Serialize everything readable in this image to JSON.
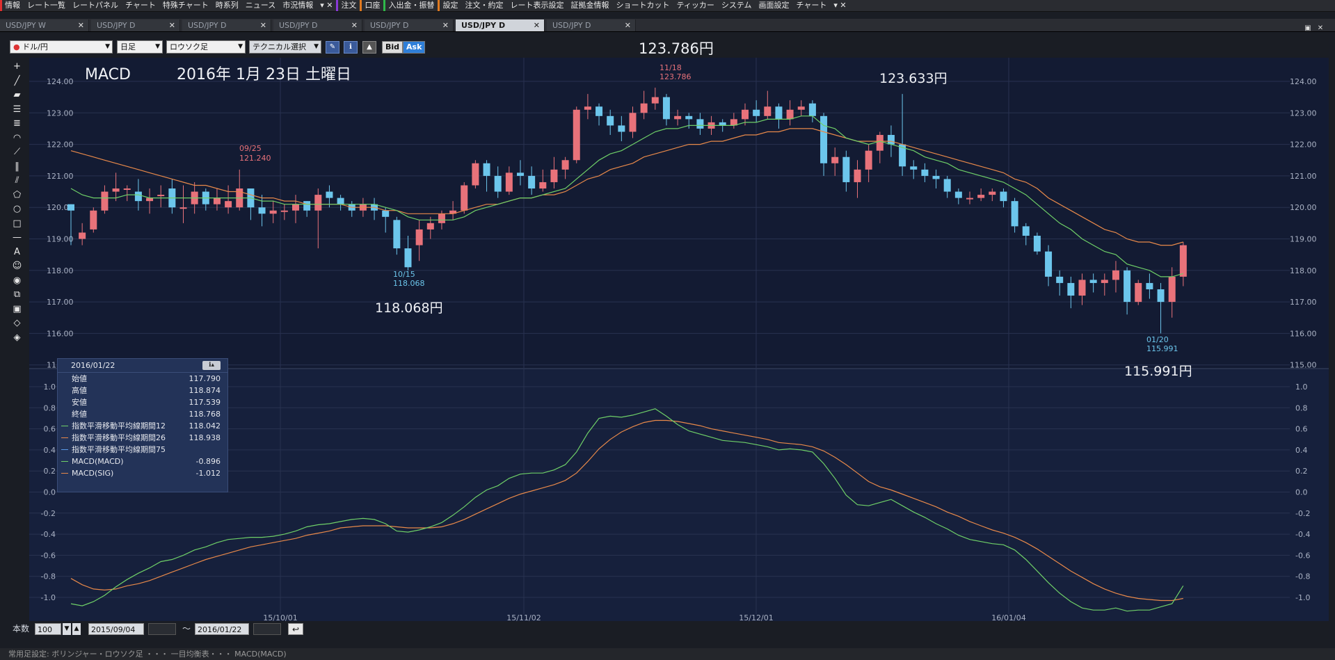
{
  "menubar": {
    "items": [
      {
        "label": "情報",
        "accent": "#e03030"
      },
      {
        "label": "レート一覧",
        "accent": ""
      },
      {
        "label": "レートパネル",
        "accent": ""
      },
      {
        "label": "チャート",
        "accent": ""
      },
      {
        "label": "特殊チャート",
        "accent": ""
      },
      {
        "label": "時系列",
        "accent": ""
      },
      {
        "label": "ニュース",
        "accent": ""
      },
      {
        "label": "市況情報",
        "accent": ""
      },
      {
        "label": "▾ ✕",
        "accent": ""
      },
      {
        "label": "注文",
        "accent": "#8a3ad8"
      },
      {
        "label": "口座",
        "accent": "#e07a20"
      },
      {
        "label": "入出金・振替",
        "accent": "#2fb84a"
      },
      {
        "label": "設定",
        "accent": "#e07a20"
      },
      {
        "label": "注文・約定",
        "accent": ""
      },
      {
        "label": "レート表示設定",
        "accent": ""
      },
      {
        "label": "証拠金情報",
        "accent": ""
      },
      {
        "label": "ショートカット",
        "accent": ""
      },
      {
        "label": "ティッカー",
        "accent": ""
      },
      {
        "label": "システム",
        "accent": ""
      },
      {
        "label": "画面設定",
        "accent": ""
      },
      {
        "label": "チャート",
        "accent": ""
      },
      {
        "label": "▾ ✕",
        "accent": ""
      }
    ]
  },
  "tabs": [
    {
      "label": "USD/JPY W",
      "active": false
    },
    {
      "label": "USD/JPY D",
      "active": false
    },
    {
      "label": "USD/JPY D",
      "active": false
    },
    {
      "label": "USD/JPY D",
      "active": false
    },
    {
      "label": "USD/JPY D",
      "active": false
    },
    {
      "label": "USD/JPY D",
      "active": true
    },
    {
      "label": "USD/JPY D",
      "active": false
    }
  ],
  "toolbar": {
    "pair": "ドル/円",
    "period": "日足",
    "chart_type": "ロウソク足",
    "technical": "テクニカル選択",
    "bid": "Bid",
    "ask": "Ask"
  },
  "top_price": "123.786円",
  "chart": {
    "title": "MACD",
    "date": "2016年 1月 23日 土曜日",
    "annotations": {
      "high1_date": "09/25",
      "high1_val": "121.240",
      "low1_date": "10/15",
      "low1_val": "118.068",
      "high2_date": "11/18",
      "high2_val": "123.786",
      "low2_date": "01/20",
      "low2_val": "115.991"
    },
    "big_labels": {
      "low1": "118.068円",
      "high": "123.633円",
      "low2": "115.991円"
    },
    "x_labels": [
      "15/10/01",
      "15/11/02",
      "15/12/01",
      "16/01/04"
    ],
    "price_ticks": [
      "124.00",
      "123.00",
      "122.00",
      "121.00",
      "120.00",
      "119.00",
      "118.00",
      "117.00",
      "116.00",
      "115.00"
    ],
    "macd_ticks": [
      "1.0",
      "0.8",
      "0.6",
      "0.4",
      "0.2",
      "0.0",
      "-0.2",
      "-0.4",
      "-0.6",
      "-0.8",
      "-1.0"
    ]
  },
  "chart_data": {
    "type": "candlestick",
    "price_range": [
      115.0,
      124.3
    ],
    "candles": [
      [
        120.1,
        119.9,
        120.1,
        118.8
      ],
      [
        119.0,
        119.2,
        119.5,
        118.8
      ],
      [
        119.3,
        119.9,
        120.0,
        119.2
      ],
      [
        119.9,
        120.5,
        120.7,
        119.8
      ],
      [
        120.5,
        120.6,
        121.1,
        120.2
      ],
      [
        120.6,
        120.6,
        120.7,
        120.2
      ],
      [
        120.5,
        120.2,
        120.9,
        119.9
      ],
      [
        120.2,
        120.3,
        120.6,
        119.8
      ],
      [
        120.4,
        120.4,
        120.7,
        120.0
      ],
      [
        120.6,
        120.0,
        120.9,
        119.8
      ],
      [
        120.0,
        120.0,
        120.7,
        119.5
      ],
      [
        120.1,
        120.5,
        120.8,
        119.8
      ],
      [
        120.5,
        120.1,
        120.6,
        119.9
      ],
      [
        120.1,
        120.3,
        120.6,
        119.9
      ],
      [
        120.0,
        120.2,
        120.7,
        119.8
      ],
      [
        120.0,
        120.6,
        121.2,
        119.9
      ],
      [
        120.6,
        120.0,
        120.6,
        119.6
      ],
      [
        120.0,
        119.8,
        120.4,
        119.4
      ],
      [
        119.8,
        119.9,
        120.2,
        119.5
      ],
      [
        119.9,
        119.9,
        120.1,
        119.6
      ],
      [
        119.9,
        120.1,
        120.4,
        119.5
      ],
      [
        120.2,
        119.9,
        120.2,
        119.7
      ],
      [
        119.9,
        120.4,
        120.6,
        118.7
      ],
      [
        120.5,
        120.3,
        120.7,
        120.0
      ],
      [
        120.3,
        120.1,
        120.4,
        119.9
      ],
      [
        120.1,
        119.9,
        120.2,
        119.7
      ],
      [
        119.9,
        120.1,
        120.3,
        119.7
      ],
      [
        120.1,
        119.9,
        120.3,
        119.6
      ],
      [
        119.9,
        119.7,
        120.0,
        119.2
      ],
      [
        119.6,
        118.7,
        119.7,
        118.5
      ],
      [
        118.7,
        118.1,
        119.1,
        118.0
      ],
      [
        118.8,
        119.3,
        119.6,
        118.3
      ],
      [
        119.3,
        119.5,
        119.7,
        119.0
      ],
      [
        119.5,
        119.8,
        119.9,
        119.3
      ],
      [
        119.8,
        119.9,
        120.2,
        119.6
      ],
      [
        119.9,
        120.7,
        120.8,
        119.8
      ],
      [
        120.7,
        121.4,
        121.5,
        120.6
      ],
      [
        121.4,
        121.0,
        121.5,
        120.5
      ],
      [
        121.0,
        120.5,
        121.3,
        120.3
      ],
      [
        120.5,
        121.1,
        121.3,
        120.4
      ],
      [
        121.1,
        121.0,
        121.5,
        120.7
      ],
      [
        121.0,
        120.6,
        121.3,
        120.4
      ],
      [
        120.6,
        120.8,
        121.2,
        120.5
      ],
      [
        120.8,
        121.2,
        121.6,
        120.6
      ],
      [
        121.2,
        121.5,
        121.6,
        120.9
      ],
      [
        121.5,
        123.1,
        123.2,
        121.4
      ],
      [
        123.1,
        123.2,
        123.6,
        122.8
      ],
      [
        123.2,
        122.9,
        123.3,
        122.6
      ],
      [
        122.9,
        122.6,
        123.1,
        122.3
      ],
      [
        122.6,
        122.4,
        122.9,
        122.1
      ],
      [
        122.4,
        123.0,
        123.2,
        122.2
      ],
      [
        123.0,
        123.3,
        123.7,
        122.8
      ],
      [
        123.3,
        123.5,
        123.8,
        123.1
      ],
      [
        123.5,
        122.8,
        123.6,
        122.6
      ],
      [
        122.8,
        122.9,
        123.1,
        122.6
      ],
      [
        122.9,
        122.8,
        123.0,
        122.5
      ],
      [
        122.8,
        122.5,
        123.0,
        122.3
      ],
      [
        122.5,
        122.7,
        122.9,
        122.3
      ],
      [
        122.7,
        122.6,
        122.8,
        122.4
      ],
      [
        122.6,
        122.8,
        123.0,
        122.5
      ],
      [
        122.8,
        123.1,
        123.3,
        122.6
      ],
      [
        123.1,
        122.9,
        123.4,
        122.7
      ],
      [
        122.9,
        123.2,
        123.7,
        122.8
      ],
      [
        123.2,
        122.8,
        123.3,
        122.5
      ],
      [
        122.8,
        123.1,
        123.4,
        122.6
      ],
      [
        123.1,
        123.2,
        123.4,
        122.9
      ],
      [
        123.3,
        122.9,
        123.4,
        122.7
      ],
      [
        122.9,
        121.4,
        123.0,
        121.0
      ],
      [
        121.4,
        121.6,
        121.9,
        121.0
      ],
      [
        121.6,
        120.8,
        121.8,
        120.5
      ],
      [
        120.8,
        121.2,
        121.5,
        120.3
      ],
      [
        121.2,
        121.8,
        122.0,
        120.8
      ],
      [
        121.8,
        122.3,
        122.4,
        121.4
      ],
      [
        122.3,
        122.0,
        122.6,
        121.6
      ],
      [
        122.0,
        121.3,
        123.6,
        121.0
      ],
      [
        121.3,
        121.2,
        121.5,
        120.9
      ],
      [
        121.2,
        121.0,
        121.4,
        120.8
      ],
      [
        121.0,
        120.9,
        121.2,
        120.6
      ],
      [
        120.9,
        120.5,
        121.0,
        120.3
      ],
      [
        120.5,
        120.3,
        120.6,
        120.1
      ],
      [
        120.3,
        120.3,
        120.5,
        120.1
      ],
      [
        120.3,
        120.4,
        120.6,
        120.2
      ],
      [
        120.4,
        120.5,
        120.6,
        120.2
      ],
      [
        120.5,
        120.2,
        120.6,
        120.0
      ],
      [
        120.2,
        119.4,
        120.3,
        119.2
      ],
      [
        119.4,
        119.1,
        119.5,
        118.8
      ],
      [
        119.1,
        118.6,
        119.2,
        118.5
      ],
      [
        118.6,
        117.8,
        118.8,
        117.5
      ],
      [
        117.8,
        117.6,
        118.0,
        117.2
      ],
      [
        117.6,
        117.2,
        117.8,
        116.8
      ],
      [
        117.2,
        117.7,
        117.9,
        116.9
      ],
      [
        117.7,
        117.6,
        117.9,
        117.3
      ],
      [
        117.6,
        117.7,
        117.9,
        117.2
      ],
      [
        117.7,
        118.0,
        118.3,
        117.3
      ],
      [
        118.0,
        117.0,
        118.1,
        116.6
      ],
      [
        117.0,
        117.6,
        117.7,
        116.9
      ],
      [
        117.6,
        117.4,
        117.9,
        117.1
      ],
      [
        117.4,
        117.0,
        117.6,
        116.0
      ],
      [
        117.0,
        117.8,
        118.1,
        116.5
      ],
      [
        117.8,
        118.8,
        118.9,
        117.5
      ]
    ],
    "ema12": [
      120.6,
      120.4,
      120.3,
      120.3,
      120.3,
      120.4,
      120.4,
      120.3,
      120.3,
      120.3,
      120.3,
      120.3,
      120.3,
      120.3,
      120.3,
      120.3,
      120.3,
      120.2,
      120.2,
      120.1,
      120.1,
      120.1,
      120.1,
      120.1,
      120.1,
      120.1,
      120.1,
      120.1,
      120.0,
      119.9,
      119.7,
      119.6,
      119.6,
      119.6,
      119.6,
      119.7,
      119.9,
      120.0,
      120.1,
      120.2,
      120.3,
      120.3,
      120.4,
      120.5,
      120.6,
      120.9,
      121.2,
      121.5,
      121.7,
      121.8,
      122.0,
      122.2,
      122.4,
      122.5,
      122.5,
      122.6,
      122.6,
      122.6,
      122.6,
      122.6,
      122.7,
      122.7,
      122.8,
      122.8,
      122.8,
      122.9,
      122.9,
      122.6,
      122.5,
      122.2,
      122.1,
      122.0,
      122.1,
      122.0,
      121.9,
      121.8,
      121.6,
      121.5,
      121.4,
      121.2,
      121.1,
      121.0,
      120.9,
      120.8,
      120.6,
      120.4,
      120.1,
      119.8,
      119.5,
      119.3,
      119.0,
      118.8,
      118.6,
      118.5,
      118.2,
      118.1,
      118.0,
      117.8,
      117.8,
      117.9
    ],
    "ema26": [
      121.8,
      121.7,
      121.6,
      121.5,
      121.4,
      121.3,
      121.2,
      121.1,
      121.0,
      120.9,
      120.8,
      120.7,
      120.7,
      120.6,
      120.5,
      120.5,
      120.4,
      120.3,
      120.3,
      120.2,
      120.2,
      120.1,
      120.1,
      120.1,
      120.1,
      120.0,
      120.0,
      120.0,
      119.9,
      119.9,
      119.8,
      119.8,
      119.8,
      119.8,
      119.8,
      119.9,
      120.0,
      120.1,
      120.1,
      120.2,
      120.3,
      120.3,
      120.4,
      120.4,
      120.5,
      120.7,
      120.9,
      121.0,
      121.2,
      121.3,
      121.4,
      121.6,
      121.7,
      121.8,
      121.9,
      122.0,
      122.0,
      122.1,
      122.1,
      122.2,
      122.3,
      122.3,
      122.4,
      122.4,
      122.5,
      122.5,
      122.5,
      122.4,
      122.3,
      122.2,
      122.1,
      122.1,
      122.1,
      122.1,
      122.0,
      121.9,
      121.8,
      121.7,
      121.6,
      121.5,
      121.4,
      121.3,
      121.2,
      121.1,
      120.9,
      120.8,
      120.6,
      120.3,
      120.1,
      119.9,
      119.7,
      119.5,
      119.3,
      119.2,
      119.0,
      118.9,
      118.9,
      118.8,
      118.8,
      118.9
    ],
    "macd_range": [
      -1.1,
      1.1
    ],
    "macd": [
      -1.06,
      -1.08,
      -1.04,
      -0.98,
      -0.9,
      -0.83,
      -0.77,
      -0.72,
      -0.66,
      -0.64,
      -0.6,
      -0.55,
      -0.52,
      -0.48,
      -0.45,
      -0.44,
      -0.43,
      -0.43,
      -0.42,
      -0.4,
      -0.37,
      -0.33,
      -0.31,
      -0.3,
      -0.28,
      -0.26,
      -0.25,
      -0.26,
      -0.3,
      -0.37,
      -0.38,
      -0.36,
      -0.33,
      -0.29,
      -0.22,
      -0.14,
      -0.05,
      0.02,
      0.06,
      0.13,
      0.17,
      0.18,
      0.18,
      0.21,
      0.26,
      0.38,
      0.56,
      0.7,
      0.72,
      0.71,
      0.73,
      0.76,
      0.79,
      0.72,
      0.64,
      0.58,
      0.55,
      0.52,
      0.49,
      0.48,
      0.47,
      0.45,
      0.43,
      0.4,
      0.41,
      0.4,
      0.38,
      0.27,
      0.13,
      -0.03,
      -0.12,
      -0.13,
      -0.1,
      -0.07,
      -0.13,
      -0.19,
      -0.24,
      -0.3,
      -0.35,
      -0.41,
      -0.45,
      -0.47,
      -0.49,
      -0.5,
      -0.55,
      -0.64,
      -0.75,
      -0.86,
      -0.96,
      -1.04,
      -1.1,
      -1.12,
      -1.12,
      -1.1,
      -1.13,
      -1.12,
      -1.12,
      -1.09,
      -1.06,
      -0.89
    ],
    "signal": [
      -0.82,
      -0.88,
      -0.92,
      -0.93,
      -0.92,
      -0.89,
      -0.87,
      -0.84,
      -0.8,
      -0.76,
      -0.72,
      -0.68,
      -0.64,
      -0.61,
      -0.58,
      -0.55,
      -0.52,
      -0.5,
      -0.48,
      -0.46,
      -0.44,
      -0.41,
      -0.39,
      -0.37,
      -0.34,
      -0.33,
      -0.32,
      -0.32,
      -0.32,
      -0.33,
      -0.34,
      -0.34,
      -0.34,
      -0.33,
      -0.3,
      -0.26,
      -0.21,
      -0.16,
      -0.11,
      -0.06,
      -0.02,
      0.01,
      0.04,
      0.07,
      0.11,
      0.18,
      0.29,
      0.41,
      0.5,
      0.57,
      0.62,
      0.66,
      0.68,
      0.68,
      0.67,
      0.65,
      0.63,
      0.6,
      0.58,
      0.56,
      0.54,
      0.52,
      0.5,
      0.47,
      0.46,
      0.45,
      0.43,
      0.39,
      0.33,
      0.26,
      0.18,
      0.1,
      0.05,
      0.02,
      -0.02,
      -0.06,
      -0.1,
      -0.14,
      -0.19,
      -0.23,
      -0.28,
      -0.32,
      -0.36,
      -0.39,
      -0.43,
      -0.48,
      -0.54,
      -0.61,
      -0.68,
      -0.75,
      -0.81,
      -0.87,
      -0.92,
      -0.96,
      -0.99,
      -1.01,
      -1.02,
      -1.03,
      -1.03,
      -1.01
    ]
  },
  "indicator_panel": {
    "date": "2016/01/22",
    "rows": [
      {
        "label": "始値",
        "value": "117.790",
        "color": ""
      },
      {
        "label": "高値",
        "value": "118.874",
        "color": ""
      },
      {
        "label": "安値",
        "value": "117.539",
        "color": ""
      },
      {
        "label": "終値",
        "value": "118.768",
        "color": ""
      },
      {
        "label": "指数平滑移動平均線期間12",
        "value": "118.042",
        "color": "#6fd068"
      },
      {
        "label": "指数平滑移動平均線期間26",
        "value": "118.938",
        "color": "#e8894a"
      },
      {
        "label": "指数平滑移動平均線期間75",
        "value": "",
        "color": "#5a9ae8"
      },
      {
        "label": "MACD(MACD)",
        "value": "-0.896",
        "color": "#6fd068"
      },
      {
        "label": "MACD(SIG)",
        "value": "-1.012",
        "color": "#e8894a"
      }
    ]
  },
  "bottom": {
    "count_label": "本数",
    "count_value": "100",
    "start_date": "2015/09/04",
    "tilde": "〜",
    "end_date": "2016/01/22"
  },
  "status": "常用足設定: ボリンジャー・ロウソク足 ・・・ 一目均衡表・・・ MACD(MACD)"
}
